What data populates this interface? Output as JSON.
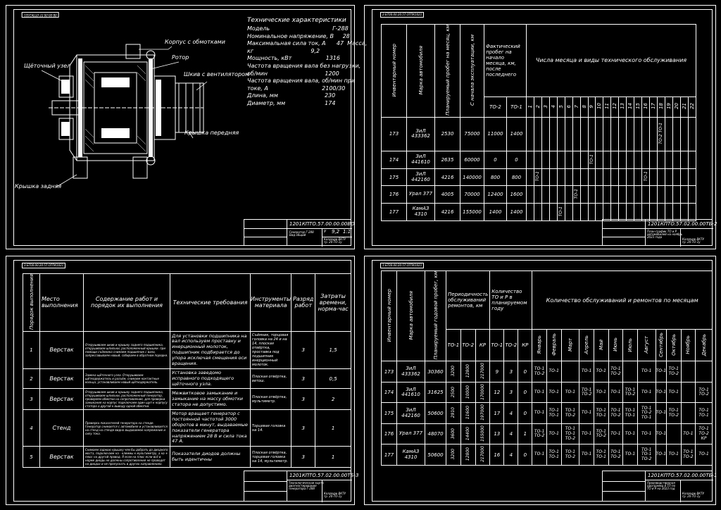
{
  "sheet1": {
    "corner_code": "0В.00.00.57.0ТПК1021",
    "spec_title": "Технические характеристики",
    "spec_lines": [
      "Модель                                   Г-288",
      "Номинальное напряжение, В     28",
      "Максимальная сила ток, А      47  Масса,",
      "кг                                9,2",
      "Мощность, кВт                   1316",
      "Частота вращения вала без нагрузки,",
      "об/мин                                1200",
      "Частота вращения вала, об/мин при",
      "токе, А                              2100/30",
      "Длина, мм                          230",
      "Диаметр, мм                      174"
    ],
    "callouts": {
      "housing": "Корпус с обмотками",
      "rotor": "Ротор",
      "pulley": "Шкив с вентилятором",
      "brush": "Щёточный узел",
      "front_cover": "Крышка передняя",
      "rear_cover": "Крышка задняя"
    },
    "stamp_code": "1201КПТО.57.00.00.00ВО",
    "stamp_name": "Генератор Г-288\nВид общий",
    "stamp_lit": "У",
    "stamp_mass": "9,2",
    "stamp_scale": "1:1",
    "stamp_org": "Колледж ВКТУ\nгр. 20-ТО-1у"
  },
  "sheet2": {
    "corner_code": "2-БТ00.00.20.57.ОТПК1021",
    "headers": {
      "inv": "Инвентарный номер",
      "brand": "Марка автомобиля",
      "planned": "Планируемый пробег на месяц, км",
      "since": "С начала эксплуатации, км",
      "actual": "Фактический пробег на начало месяца, км, после последнего",
      "to2": "ТО-2",
      "to1": "ТО-1",
      "days_title": "Числа месяца и виды технического обслуживания"
    },
    "days": [
      "1",
      "2",
      "3",
      "4",
      "5",
      "6",
      "7",
      "8",
      "9",
      "10",
      "11",
      "12",
      "13",
      "14",
      "15",
      "16",
      "17",
      "18",
      "19",
      "20",
      "21",
      "22"
    ],
    "rows": [
      {
        "inv": "173",
        "brand": "ЗиЛ 433362",
        "planned": "2530",
        "since": "75000",
        "to2": "11000",
        "to1": "1400"
      },
      {
        "inv": "174",
        "brand": "ЗиЛ 441610",
        "planned": "2635",
        "since": "60000",
        "to2": "0",
        "to1": "0"
      },
      {
        "inv": "175",
        "brand": "ЗиЛ 442160",
        "planned": "4216",
        "since": "140000",
        "to2": "800",
        "to1": "800"
      },
      {
        "inv": "176",
        "brand": "Урал 377",
        "planned": "4005",
        "since": "70000",
        "to2": "12400",
        "to1": "1600"
      },
      {
        "inv": "177",
        "brand": "КамАЗ 4310",
        "planned": "4216",
        "since": "155000",
        "to2": "1400",
        "to1": "1400"
      }
    ],
    "marks": [
      {
        "row": 0,
        "label": "ТО-2 ТО-1"
      },
      {
        "row": 1,
        "label": "ТО-1"
      },
      {
        "row": 2,
        "label": "ТО-1"
      },
      {
        "row": 2,
        "label": "ТО-1"
      },
      {
        "row": 3,
        "label": "ТО-1"
      },
      {
        "row": 4,
        "label": "ТО-1"
      }
    ],
    "stamp_code": "1201КПТО.57.02.00.00ТБ-2",
    "stamp_name": "План-график ТО и Р\nавтомобилей на ноябрь\n2023 года",
    "stamp_org": "Колледж ВКТУ\nгр. 20-ТО-1у"
  },
  "sheet3": {
    "corner_code": "3-БТ00.00.20.57.ОТПК1021",
    "headers": {
      "num": "Порядок выполнения",
      "place": "Место выполнения",
      "content": "Содержание работ и порядок их выполнения",
      "req": "Технические требования",
      "tools": "Инструменты материала",
      "grade": "Разряд работ",
      "time": "Затраты времени, норма-час"
    },
    "rows": [
      {
        "num": "1",
        "place": "Верстак",
        "content": "Открушиваем шкив и крышку заднего подшипника, открушиваем шпильки, расположенный крышки. при помощи съёмника снимаем подшипник с вала, запрессовываем новый, собираем в обратном порядке.",
        "req": "Для установки подшипника на вал используем проставку и инерционный молоток, подшипник подбирается до упора исключая смещения оси вращения.",
        "tools": "Съёмник, торцовая головка на 24 и на 14, плоская отвёртка, проставка под подшипник инерционный молоток.",
        "grade": "3",
        "time": "1,5"
      },
      {
        "num": "2",
        "place": "Верстак",
        "content": "Замена щёточного узла. Открушиваем щёткодержатель и разъём, снимаем контактные кольца, устанавливаем новый щёткодержатель.",
        "req": "Установка заведомо исправного подходящего щёточного узла.",
        "tools": "Плоская отвёртка, ветош.",
        "grade": "3",
        "time": "0,5"
      },
      {
        "num": "3",
        "place": "Верстак",
        "content": "Открушиваем шкив и крышку заднего подшипника, открушиваем шпильки, расположенный генератор, проверяем обмотки на сопротивление, для проверки замыкания на корпус подключаем один щуп к корпусу статора а другой к выводу одной обмотки.",
        "req": "Межвитковое замыкание и замыкание на массу обмотки статора не допустимо.",
        "tools": "Плоская отвёртка, мультиметр.",
        "grade": "3",
        "time": "2"
      },
      {
        "num": "4",
        "place": "Стенд",
        "content": "Проверка показателей генератора на стенде. Генератор снимается с автомобиля и устанавливается на стенд на стенде видно выдаваемое напряжение и силу тока.",
        "req": "Мотор вращает генератор с постоянной частотой 3000 оборотов в минут, выдаваемые показатели генератора напряжением 28 В и сила тока 47 А.",
        "tools": "Торцевая головка на 14.",
        "grade": "3",
        "time": "1"
      },
      {
        "num": "5",
        "place": "Верстак",
        "content": "Снимаем заднюю крышку чем бы добрать до диодного моста, подключаем на - клеммы к мультиметру, а на + плюс на другой провод. Я если на плюс если всё в норме диоды не должны сопротивления не проводят на диодах и не пропускать в других направлениях.",
        "req": "Показатели диодов должны быть идентичны",
        "tools": "Плоская отвёртка, торцевая головка на 14, мультиметр.",
        "grade": "3",
        "time": "1"
      }
    ],
    "stamp_code": "1201КПТО.57.02.00.00ТБ-3",
    "stamp_name": "Технологическая карта\nдиагностирования\nгенератора Г-288",
    "stamp_org": "Колледж ВКТУ\nгр. 20-ТО-1у"
  },
  "sheet4": {
    "corner_code": "1-БТ00.00.20.57.ОТПК1021",
    "headers": {
      "inv": "Инвентарный номер",
      "brand": "Марка автомобиля",
      "annual": "Планируемый годовой пробег, км",
      "period": "Периодичность обслуживаний ремонтов, км",
      "count": "Количество ТО и Р в планируемом году",
      "months_title": "Количество обслуживаний и ремонтов по месяцам",
      "to1": "ТО-1",
      "to2": "ТО-2",
      "kr": "КР"
    },
    "months": [
      "Январь",
      "Февраль",
      "Март",
      "Апрель",
      "Май",
      "Июнь",
      "Июль",
      "Август",
      "Сентябрь",
      "Октябрь",
      "Ноябрь",
      "Декабрь"
    ],
    "rows": [
      {
        "inv": "173",
        "brand": "ЗиЛ 433362",
        "annual": "30360",
        "p1": "3200",
        "p2": "12800",
        "pk": "217000",
        "c1": "9",
        "c2": "3",
        "ck": "0",
        "m": [
          "ТО-1 ТО-2",
          "ТО-1",
          "",
          "ТО-1",
          "ТО-1",
          "ТО-1 ТО-2",
          "",
          "ТО-1",
          "ТО-1",
          "ТО-1 ТО-2",
          "",
          ""
        ]
      },
      {
        "inv": "174",
        "brand": "ЗиЛ 441610",
        "annual": "31625",
        "p1": "2500",
        "p2": "10000",
        "pk": "170000",
        "c1": "12",
        "c2": "3",
        "ck": "0",
        "m": [
          "ТО-1",
          "ТО-1",
          "ТО-1",
          "ТО-1 ТО-2",
          "ТО-1",
          "ТО-1",
          "ТО-1 ТО-2",
          "ТО-1",
          "ТО-1",
          "ТО-1",
          "",
          "ТО-1 ТО-2"
        ]
      },
      {
        "inv": "175",
        "brand": "ЗиЛ 442160",
        "annual": "50600",
        "p1": "2910",
        "p2": "11600",
        "pk": "197000",
        "c1": "17",
        "c2": "4",
        "ck": "0",
        "m": [
          "ТО-1",
          "ТО-1 ТО-1",
          "ТО-1 ТО-2",
          "ТО-1",
          "ТО-1 ТО-1",
          "ТО-1 ТО-2",
          "ТО-1 ТО-1",
          "ТО-1 ТО-2 ТО-1",
          "ТО-1",
          "ТО-1 ТО-2",
          "",
          "ТО-1 ТО-1"
        ]
      },
      {
        "inv": "176",
        "brand": "Урал 377",
        "annual": "48070",
        "p1": "3600",
        "p2": "14400",
        "pk": "155000",
        "c1": "13",
        "c2": "4",
        "ck": "1",
        "m": [
          "ТО-1 ТО-2",
          "ТО-1",
          "ТО-1 ТО-1 ТО-2",
          "ТО-1",
          "ТО-1 ТО-2",
          "ТО-1",
          "ТО-1",
          "ТО-1",
          "ТО-1",
          "",
          "ТО-1",
          "ТО-1 ТО-2 КР"
        ]
      },
      {
        "inv": "177",
        "brand": "КамАЗ 4310",
        "annual": "50600",
        "p1": "3200",
        "p2": "12800",
        "pk": "217000",
        "c1": "16",
        "c2": "4",
        "ck": "0",
        "m": [
          "ТО-1",
          "ТО-1 ТО-1",
          "ТО-1 ТО-2",
          "ТО-1",
          "ТО-1 ТО-1",
          "ТО-1 ТО-2",
          "ТО-1",
          "ТО-1 ТО-1 ТО-2",
          "ТО-1",
          "ТО-1",
          "ТО-1 ТО-2",
          "ТО-1"
        ]
      }
    ],
    "stamp_code": "1201КПТО.57.02.00.00ТБ-1",
    "stamp_name": "Производственная программа 4 ТП по ТО и Р на 2023 год",
    "stamp_org": "Колледж ВКТУ\nгр. 20-ТО-1у"
  }
}
